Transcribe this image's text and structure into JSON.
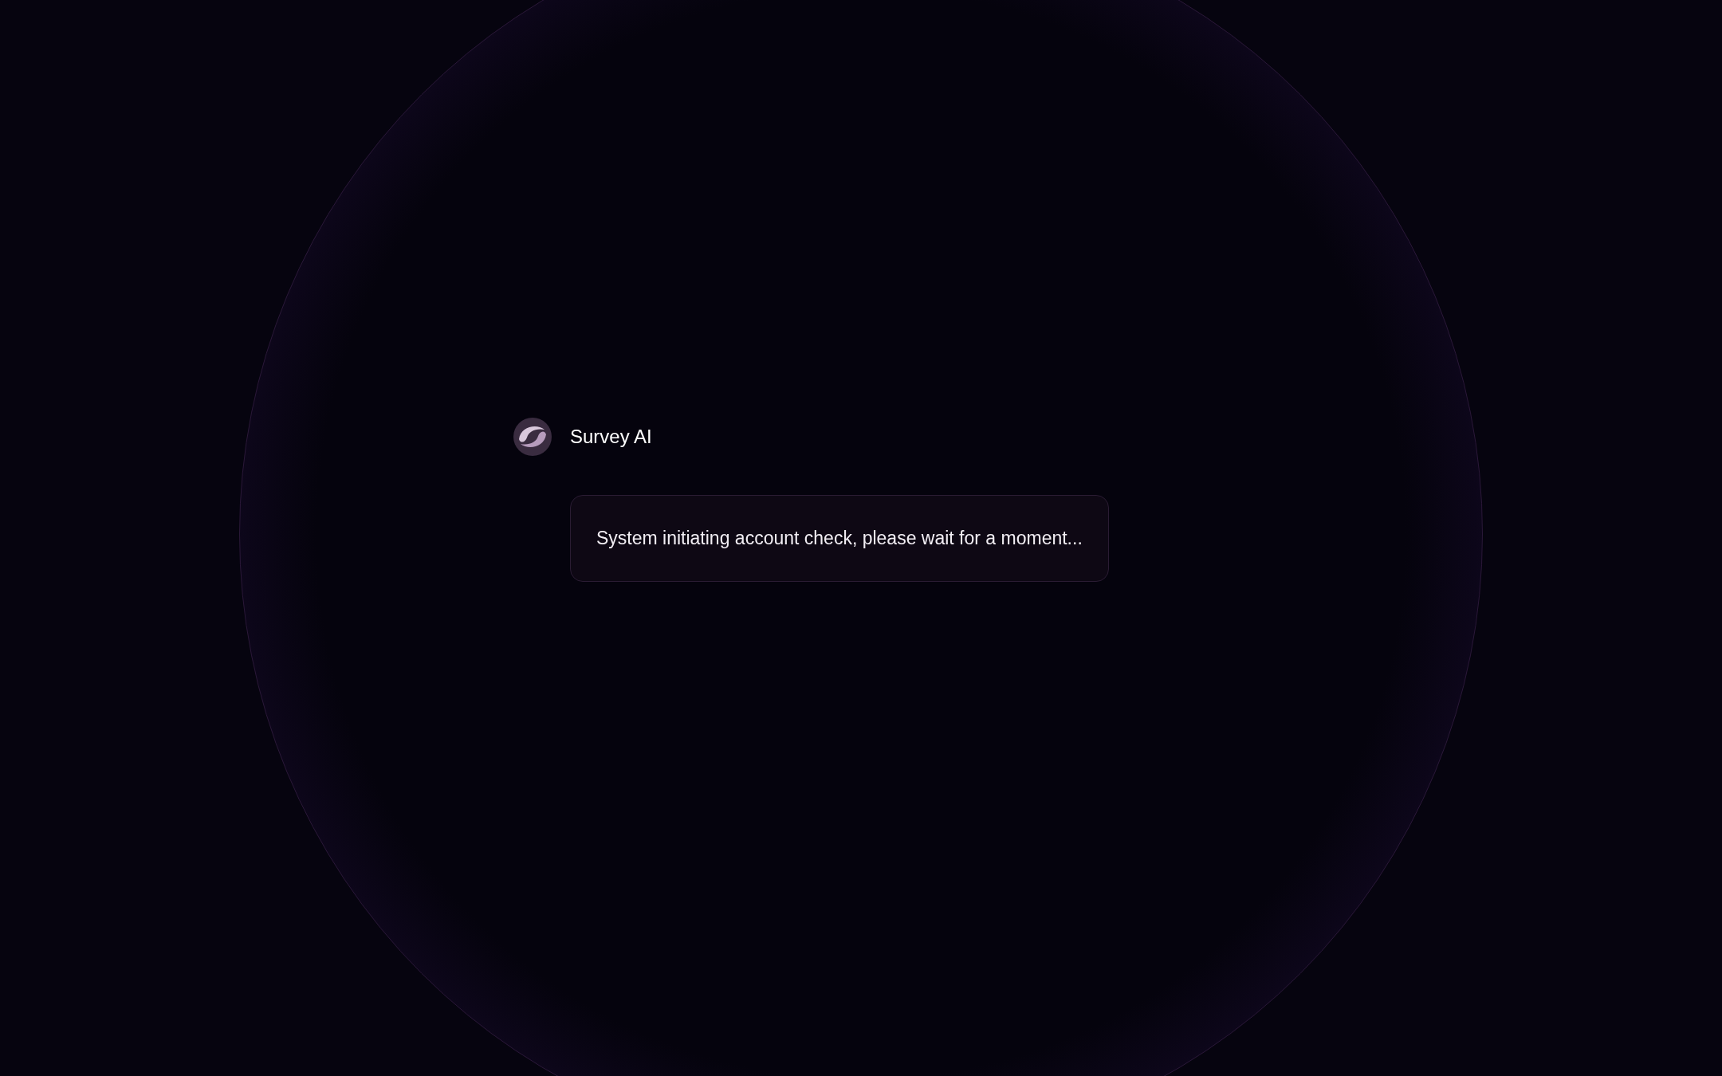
{
  "assistant": {
    "name": "Survey AI"
  },
  "message": {
    "text": "System initiating account check, please wait for a moment..."
  }
}
